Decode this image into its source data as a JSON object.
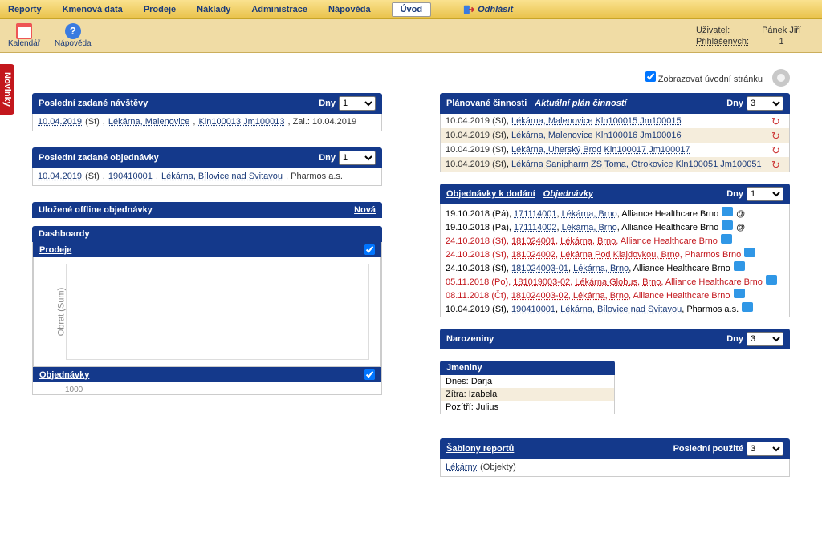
{
  "menu": {
    "items": [
      "Reporty",
      "Kmenová data",
      "Prodeje",
      "Náklady",
      "Administrace",
      "Nápověda",
      "Úvod"
    ],
    "active_index": 6,
    "logout": "Odhlásit"
  },
  "toolbar": {
    "calendar": "Kalendář",
    "help": "Nápověda",
    "user_label": "Uživatel:",
    "user": "Pánek Jiří",
    "logged_label": "Přihlášených:",
    "logged_count": "1"
  },
  "side_tab": "Novinky",
  "topline": {
    "show_intro": "Zobrazovat úvodní stránku",
    "checked": true
  },
  "left": {
    "visits": {
      "title": "Poslední zadané návštěvy",
      "dny_label": "Dny",
      "dny_value": "1",
      "row": {
        "date": "10.04.2019",
        "day": "(St)",
        "pharmacy": "Lékárna, Malenovice",
        "code": "Kln100013 Jm100013",
        "suffix": ", Zal.: 10.04.2019"
      }
    },
    "orders": {
      "title": "Poslední zadané objednávky",
      "dny_label": "Dny",
      "dny_value": "1",
      "row": {
        "date": "10.04.2019",
        "day": "(St)",
        "num": "190410001",
        "pharmacy": "Lékárna, Bílovice nad Svitavou",
        "suffix": ", Pharmos a.s."
      }
    },
    "offline": {
      "title": "Uložené offline objednávky",
      "new": "Nová"
    },
    "dashboards": {
      "title": "Dashboardy",
      "sales_title": "Prodeje",
      "ylabel": "Obrat (Sum)",
      "orders_title": "Objednávky",
      "tick": "1000"
    }
  },
  "right": {
    "plan": {
      "title": "Plánované činnosti",
      "title2": "Aktuální plán činností",
      "dny_label": "Dny",
      "dny_value": "3",
      "rows": [
        {
          "date": "10.04.2019",
          "day": "(St)",
          "ph": "Lékárna, Malenovice",
          "code": "Kln100015 Jm100015"
        },
        {
          "date": "10.04.2019",
          "day": "(St)",
          "ph": "Lékárna, Malenovice",
          "code": "Kln100016 Jm100016"
        },
        {
          "date": "10.04.2019",
          "day": "(St)",
          "ph": "Lékárna, Uherský Brod",
          "code": "Kln100017 Jm100017"
        },
        {
          "date": "10.04.2019",
          "day": "(St)",
          "ph": "Lékárna Sanipharm ZS Toma, Otrokovice",
          "code": "Kln100051 Jm100051"
        }
      ]
    },
    "deliver": {
      "title": "Objednávky k dodání",
      "title2": "Objednávky",
      "dny_label": "Dny",
      "dny_value": "1",
      "rows": [
        {
          "date": "19.10.2018",
          "day": "(Pá)",
          "num": "171114001",
          "ph": "Lékárna, Brno",
          "suf": ", Alliance Healthcare Brno",
          "at": true,
          "red": false
        },
        {
          "date": "19.10.2018",
          "day": "(Pá)",
          "num": "171114002",
          "ph": "Lékárna, Brno",
          "suf": ", Alliance Healthcare Brno",
          "at": true,
          "red": false
        },
        {
          "date": "24.10.2018",
          "day": "(St)",
          "num": "181024001",
          "ph": "Lékárna, Brno",
          "suf": ", Alliance Healthcare Brno",
          "at": false,
          "red": true
        },
        {
          "date": "24.10.2018",
          "day": "(St)",
          "num": "181024002",
          "ph": "Lékárna Pod Klajdovkou, Brno",
          "suf": ", Pharmos Brno",
          "at": false,
          "red": true
        },
        {
          "date": "24.10.2018",
          "day": "(St)",
          "num": "181024003-01",
          "ph": "Lékárna, Brno",
          "suf": ", Alliance Healthcare Brno",
          "at": false,
          "red": false
        },
        {
          "date": "05.11.2018",
          "day": "(Po)",
          "num": "181019003-02",
          "ph": "Lékárna Globus, Brno",
          "suf": ", Alliance Healthcare Brno",
          "at": false,
          "red": true
        },
        {
          "date": "08.11.2018",
          "day": "(Čt)",
          "num": "181024003-02",
          "ph": "Lékárna, Brno",
          "suf": ", Alliance Healthcare Brno",
          "at": false,
          "red": true
        },
        {
          "date": "10.04.2019",
          "day": "(St)",
          "num": "190410001",
          "ph": "Lékárna, Bílovice nad Svitavou",
          "suf": ", Pharmos a.s.",
          "at": false,
          "red": false
        }
      ]
    },
    "birthday": {
      "title": "Narozeniny",
      "dny_label": "Dny",
      "dny_value": "3"
    },
    "nameday": {
      "title": "Jmeniny",
      "today_label": "Dnes:",
      "today_name": "Darja",
      "tomorrow_label": "Zítra:",
      "tomorrow_name": "Izabela",
      "after_label": "Pozítří:",
      "after_name": "Julius"
    },
    "reports": {
      "title": "Šablony reportů",
      "right_label": "Poslední použité",
      "value": "3",
      "row_name": "Lékárny",
      "row_suffix": " (Objekty)"
    }
  }
}
